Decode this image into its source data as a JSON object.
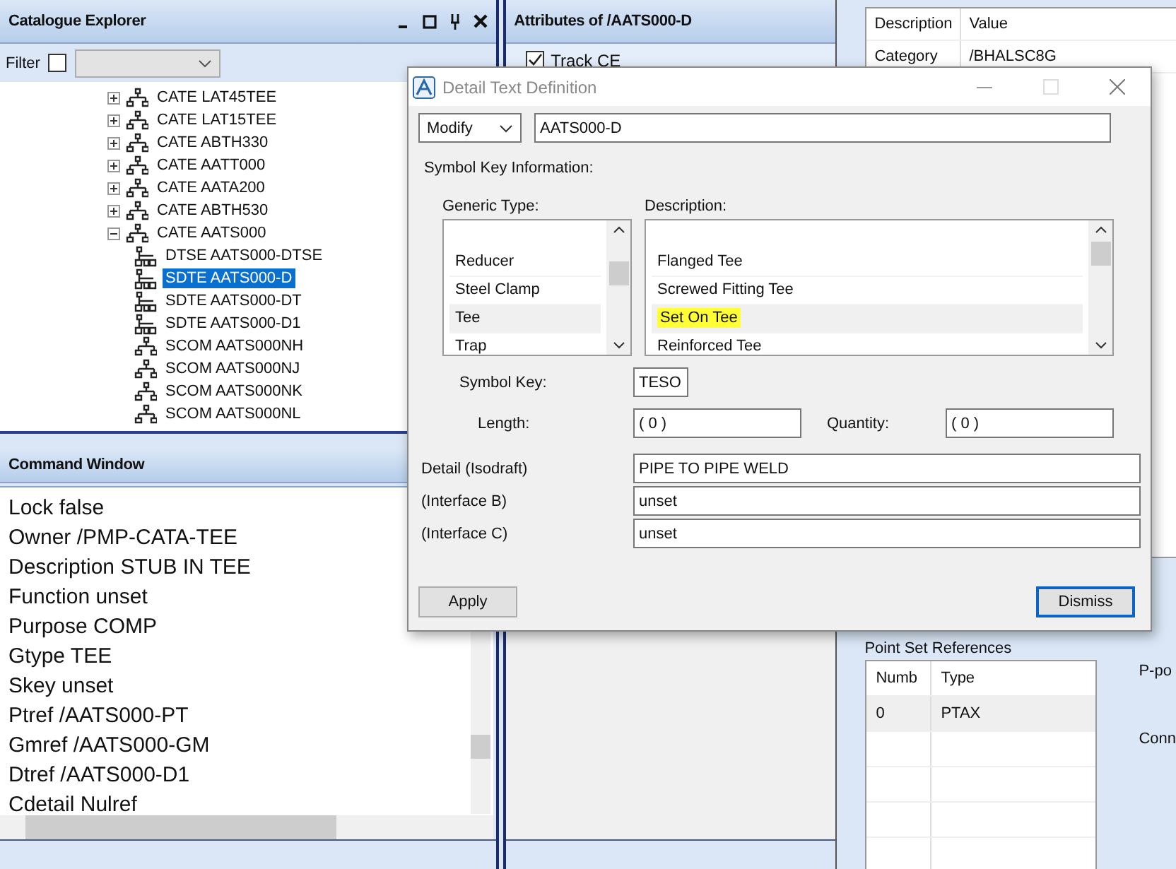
{
  "catalogue_explorer": {
    "title": "Catalogue Explorer",
    "filter_label": "Filter",
    "filter_checked": false,
    "tree": [
      {
        "label": "CATE LAT45TEE",
        "kind": "category",
        "expanded": false,
        "selected": false
      },
      {
        "label": "CATE LAT15TEE",
        "kind": "category",
        "expanded": false,
        "selected": false
      },
      {
        "label": "CATE ABTH330",
        "kind": "category",
        "expanded": false,
        "selected": false
      },
      {
        "label": "CATE AATT000",
        "kind": "category",
        "expanded": false,
        "selected": false
      },
      {
        "label": "CATE AATA200",
        "kind": "category",
        "expanded": false,
        "selected": false
      },
      {
        "label": "CATE ABTH530",
        "kind": "category",
        "expanded": false,
        "selected": false
      },
      {
        "label": "CATE AATS000",
        "kind": "category",
        "expanded": true,
        "selected": false,
        "children": [
          {
            "label": "DTSE AATS000-DTSE",
            "kind": "detail",
            "selected": false
          },
          {
            "label": "SDTE AATS000-D",
            "kind": "detail",
            "selected": true
          },
          {
            "label": "SDTE AATS000-DT",
            "kind": "detail",
            "selected": false
          },
          {
            "label": "SDTE AATS000-D1",
            "kind": "detail",
            "selected": false
          },
          {
            "label": "SCOM AATS000NH",
            "kind": "component",
            "selected": false
          },
          {
            "label": "SCOM AATS000NJ",
            "kind": "component",
            "selected": false
          },
          {
            "label": "SCOM AATS000NK",
            "kind": "component",
            "selected": false
          },
          {
            "label": "SCOM AATS000NL",
            "kind": "component",
            "selected": false
          }
        ]
      }
    ]
  },
  "command_window": {
    "title": "Command Window",
    "lines": [
      "Lock false",
      "Owner /PMP-CATA-TEE",
      "Description STUB IN TEE",
      "Function unset",
      "Purpose COMP",
      "Gtype TEE",
      "Skey unset",
      "Ptref /AATS000-PT",
      "Gmref /AATS000-GM",
      "Dtref /AATS000-D1",
      "Cdetail Nulref"
    ]
  },
  "attributes": {
    "title": "Attributes of /AATS000-D",
    "track_ce": {
      "label": "Track CE",
      "checked": true
    }
  },
  "properties": {
    "columns": [
      "Description",
      "Value"
    ],
    "rows": [
      [
        "Category",
        "/BHALSC8G"
      ]
    ]
  },
  "point_sets": {
    "title": "Point Set References",
    "columns": [
      "Numb",
      "Type"
    ],
    "rows": [
      [
        "0",
        "PTAX"
      ]
    ],
    "side_labels": [
      "P-po",
      "Conn"
    ]
  },
  "dialog": {
    "title": "Detail Text Definition",
    "mode": "Modify",
    "name": "AATS000-D",
    "section": "Symbol Key Information:",
    "generic_type": {
      "label": "Generic Type:",
      "items": [
        {
          "label": "Reducer",
          "selected": false
        },
        {
          "label": "Steel Clamp",
          "selected": false
        },
        {
          "label": "Tee",
          "selected": true
        },
        {
          "label": "Trap",
          "selected": false
        }
      ]
    },
    "description": {
      "label": "Description:",
      "items": [
        {
          "label": "Flanged Tee",
          "selected": false,
          "highlighted": false
        },
        {
          "label": "Screwed Fitting Tee",
          "selected": false,
          "highlighted": false
        },
        {
          "label": "Set On Tee",
          "selected": true,
          "highlighted": true
        },
        {
          "label": "Reinforced Tee",
          "selected": false,
          "highlighted": false
        }
      ]
    },
    "symbol_key": {
      "label": "Symbol Key:",
      "value": "TESO"
    },
    "length": {
      "label": "Length:",
      "value": "( 0 )"
    },
    "quantity": {
      "label": "Quantity:",
      "value": "( 0 )"
    },
    "details": [
      {
        "label": "Detail (Isodraft)",
        "value": "PIPE TO PIPE WELD"
      },
      {
        "label": "(Interface B)",
        "value": "unset"
      },
      {
        "label": "(Interface C)",
        "value": "unset"
      }
    ],
    "buttons": [
      {
        "label": "Apply",
        "default": false
      },
      {
        "label": "Dismiss",
        "default": true
      }
    ]
  }
}
